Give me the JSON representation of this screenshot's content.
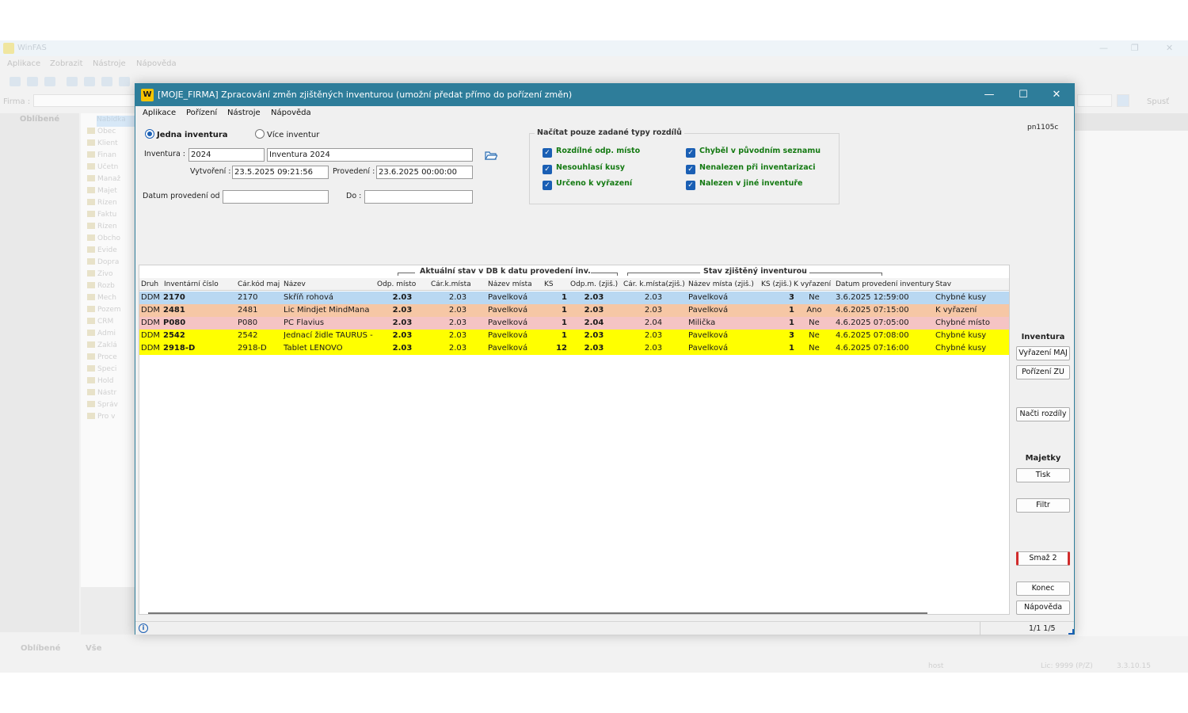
{
  "background_app": {
    "title": "WinFAS",
    "menu": [
      "Aplikace",
      "Zobrazit",
      "Nástroje",
      "Nápověda"
    ],
    "firma_label": "Firma :",
    "spust_label": "Spusť",
    "left_header": "Oblíbené",
    "tree_items": [
      "Obec",
      "Klient",
      "Finan",
      "Účetn",
      "Manaž",
      "Majet",
      "Řízen",
      "Faktu",
      "Řízen",
      "Obcho",
      "Evide",
      "Dopra",
      "Živo",
      "Rozb",
      "Mech",
      "Pozem",
      "CRM",
      "Admi",
      "Zaklá",
      "Proce",
      "Speci",
      "Hold",
      "Nástr",
      "Správ",
      "Pro v"
    ],
    "tree_selected": "Nabídka",
    "status_left": "Oblíbené",
    "status_right": "Vše",
    "footer_host": "host",
    "footer_lic": "Lic: 9999  (P/Z)",
    "footer_ver": "3.3.10.15"
  },
  "dialog": {
    "logo": "W",
    "title": "[MOJE_FIRMA] Zpracování změn zjištěných inventurou (umožní předat přímo do pořízení změn)",
    "window_controls": {
      "minimize": "—",
      "maximize": "☐",
      "close": "✕"
    },
    "menu": [
      "Aplikace",
      "Pořízení",
      "Nástroje",
      "Nápověda"
    ],
    "code": "pn1105c",
    "radio_single": "Jedna inventura",
    "radio_multi": "Více inventur",
    "inventura_label": "Inventura :",
    "inventura_code": "2024",
    "inventura_name": "Inventura 2024",
    "vytvoreni_label": "Vytvoření :",
    "vytvoreni_value": "23.5.2025 09:21:56",
    "provedeni_label": "Provedení :",
    "provedeni_value": "23.6.2025 00:00:00",
    "datum_od_label": "Datum provedení od :",
    "datum_od_value": "",
    "do_label": "Do :",
    "do_value": "",
    "filter_group_title": "Načítat pouze zadané typy rozdílů",
    "filters": [
      "Rozdílné odp. místo",
      "Nesouhlasí kusy",
      "Určeno k vyřazení",
      "Chyběl v původním seznamu",
      "Nenalezen při inventarizaci",
      "Nalezen v jiné inventuře"
    ],
    "grid": {
      "group_db": "Aktuální stav v DB k datu provedení inv.",
      "group_inv": "Stav zjištěný inventurou",
      "columns": [
        "Druh",
        "Inventární číslo",
        "Čár.kód maj",
        "Název",
        "Odp. místo",
        "Čár.k.místa",
        "Název místa",
        "KS",
        "Odp.m. (zjiš.)",
        "Čár. k.místa(zjiš.)",
        "Název místa (zjiš.)",
        "KS (zjiš.)",
        "K vyřazení",
        "Datum provedení inventury",
        "Stav"
      ],
      "rows": [
        {
          "druh": "DDM",
          "inv": "2170",
          "kod": "2170",
          "nazev": "Skříň rohová",
          "odp": "2.03",
          "kmista": "2.03",
          "nmista": "Pavelková",
          "ks": "1",
          "odpz": "2.03",
          "kmistaz": "2.03",
          "nmistaz": "Pavelková",
          "ksz": "3",
          "vyr": "Ne",
          "datum": "3.6.2025 12:59:00",
          "stav": "Chybné kusy",
          "bg": "#b9d8f2"
        },
        {
          "druh": "DDM",
          "inv": "2481",
          "kod": "2481",
          "nazev": "Lic Mindjet MindMana",
          "odp": "2.03",
          "kmista": "2.03",
          "nmista": "Pavelková",
          "ks": "1",
          "odpz": "2.03",
          "kmistaz": "2.03",
          "nmistaz": "Pavelková",
          "ksz": "1",
          "vyr": "Ano",
          "datum": "4.6.2025 07:15:00",
          "stav": "K vyřazení",
          "bg": "#f6c7a5"
        },
        {
          "druh": "DDM",
          "inv": "P080",
          "kod": "P080",
          "nazev": "PC Flavius",
          "odp": "2.03",
          "kmista": "2.03",
          "nmista": "Pavelková",
          "ks": "1",
          "odpz": "2.04",
          "kmistaz": "2.04",
          "nmistaz": "Milička",
          "ksz": "1",
          "vyr": "Ne",
          "datum": "4.6.2025 07:05:00",
          "stav": "Chybné místo",
          "bg": "#f5c4c4"
        },
        {
          "druh": "DDM",
          "inv": "2542",
          "kod": "2542",
          "nazev": "Jednací židle TAURUS -",
          "odp": "2.03",
          "kmista": "2.03",
          "nmista": "Pavelková",
          "ks": "1",
          "odpz": "2.03",
          "kmistaz": "2.03",
          "nmistaz": "Pavelková",
          "ksz": "3",
          "vyr": "Ne",
          "datum": "4.6.2025 07:08:00",
          "stav": "Chybné kusy",
          "bg": "#ffff00"
        },
        {
          "druh": "DDM",
          "inv": "2918-D",
          "kod": "2918-D",
          "nazev": "Tablet LENOVO",
          "odp": "2.03",
          "kmista": "2.03",
          "nmista": "Pavelková",
          "ks": "12",
          "odpz": "2.03",
          "kmistaz": "2.03",
          "nmistaz": "Pavelková",
          "ksz": "1",
          "vyr": "Ne",
          "datum": "4.6.2025 07:16:00",
          "stav": "Chybné kusy",
          "bg": "#ffff00"
        }
      ]
    },
    "side": {
      "inventura_header": "Inventura",
      "vyrazeni_maj": "Vyřazení MAJ",
      "porizeni_zu": "Pořízení ZU",
      "nacti_rozdily": "Načti rozdíly",
      "majetky_header": "Majetky",
      "tisk": "Tisk",
      "filtr": "Filtr",
      "smaz": "Smaž 2",
      "konec": "Konec",
      "napoveda": "Nápověda"
    },
    "status": {
      "info_icon": "i",
      "page": "1/1  1/5"
    }
  }
}
